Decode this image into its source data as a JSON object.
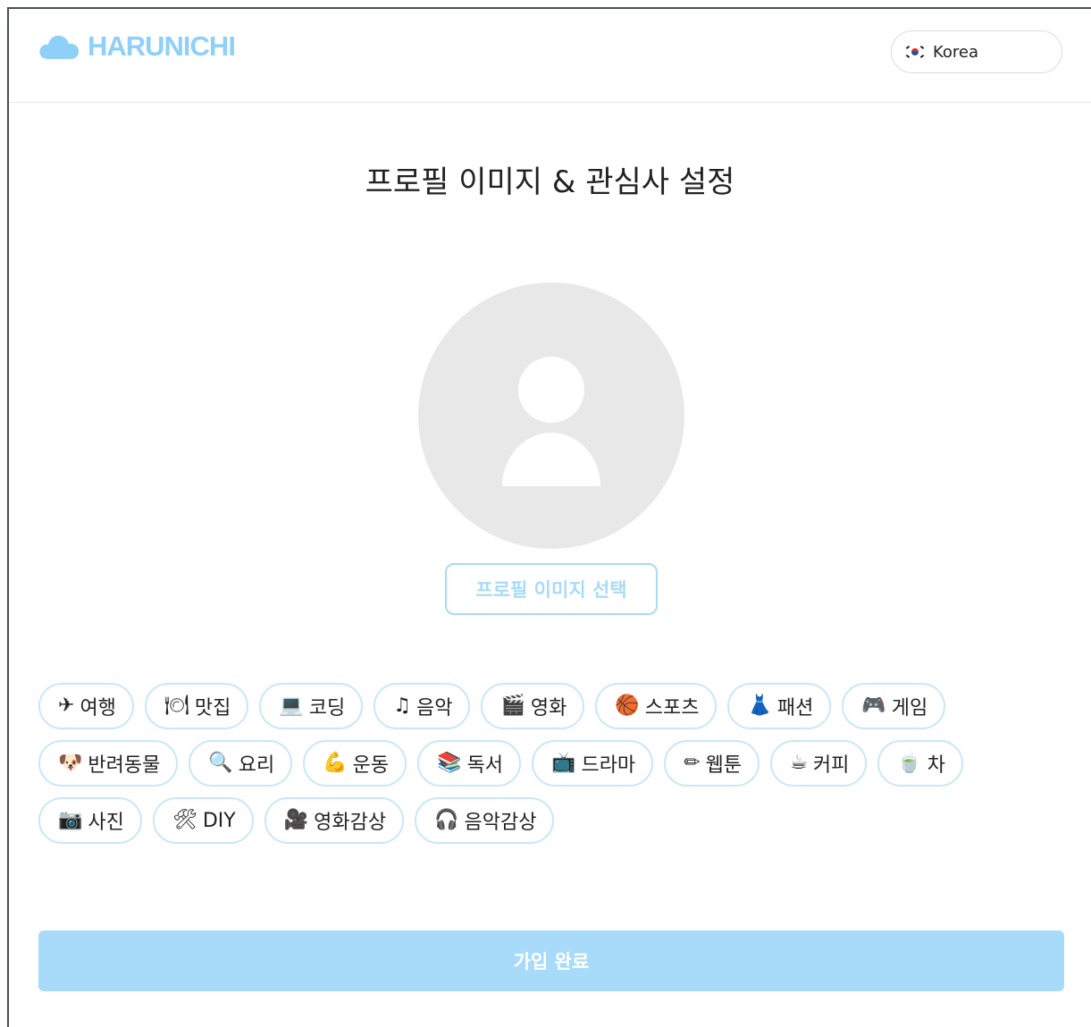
{
  "header": {
    "logo_text": "HARUNICHI",
    "language": "Korea"
  },
  "main": {
    "title": "프로필 이미지 & 관심사 설정",
    "choose_image_label": "프로필 이미지 선택",
    "submit_label": "가입 완료"
  },
  "interests": {
    "row1": [
      {
        "icon": "✈",
        "label": "여행",
        "icon_name": "airplane-icon"
      },
      {
        "icon": "🍽",
        "label": "맛집",
        "icon_name": "dining-icon"
      },
      {
        "icon": "💻",
        "label": "코딩",
        "icon_name": "laptop-icon"
      },
      {
        "icon": "♫",
        "label": "음악",
        "icon_name": "music-note-icon"
      },
      {
        "icon": "🎬",
        "label": "영화",
        "icon_name": "clapperboard-icon"
      },
      {
        "icon": "🏀",
        "label": "스포츠",
        "icon_name": "basketball-icon"
      },
      {
        "icon": "👗",
        "label": "패션",
        "icon_name": "dress-icon"
      },
      {
        "icon": "🎮",
        "label": "게임",
        "icon_name": "gamepad-icon"
      }
    ],
    "row2": [
      {
        "icon": "🐶",
        "label": "반려동물",
        "icon_name": "dog-icon"
      },
      {
        "icon": "🔍",
        "label": "요리",
        "icon_name": "magnifier-icon"
      },
      {
        "icon": "💪",
        "label": "운동",
        "icon_name": "muscle-icon"
      },
      {
        "icon": "📚",
        "label": "독서",
        "icon_name": "books-icon"
      },
      {
        "icon": "📺",
        "label": "드라마",
        "icon_name": "tv-icon"
      },
      {
        "icon": "✏",
        "label": "웹툰",
        "icon_name": "pencil-icon"
      },
      {
        "icon": "☕",
        "label": "커피",
        "icon_name": "coffee-icon"
      },
      {
        "icon": "🍵",
        "label": "차",
        "icon_name": "tea-icon"
      }
    ],
    "row3": [
      {
        "icon": "📷",
        "label": "사진",
        "icon_name": "camera-icon"
      },
      {
        "icon": "🛠",
        "label": "DIY",
        "icon_name": "tools-icon"
      },
      {
        "icon": "🎥",
        "label": "영화감상",
        "icon_name": "movie-camera-icon"
      },
      {
        "icon": "🎧",
        "label": "음악감상",
        "icon_name": "headphones-icon"
      }
    ]
  },
  "colors": {
    "accent": "#8fd0f8",
    "tag_border": "#c9e7f8",
    "button_disabled": "#a8dbfa",
    "avatar_bg": "#e8e8e8"
  }
}
